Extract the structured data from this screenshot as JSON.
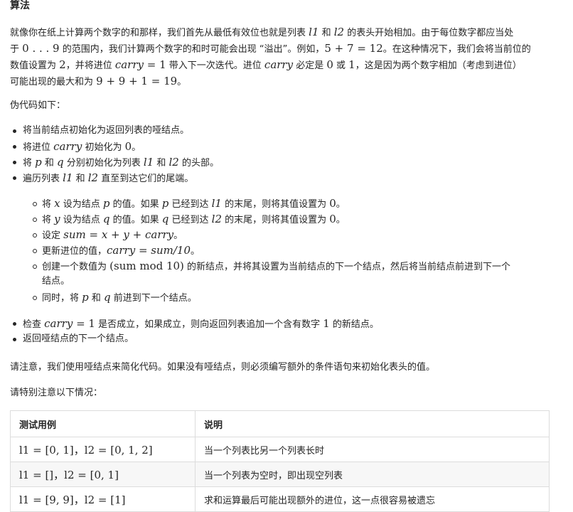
{
  "section_title": "算法",
  "para1": {
    "l1_a": "就像你在纸上计算两个数字的和那样，我们首先从最低有效位也就是列表 ",
    "l1_m1": "l1",
    "l1_b": " 和 ",
    "l1_m2": "l2",
    "l1_c": " 的表头开始相加。由于每位数字都应当处",
    "l2_a": "于 ",
    "l2_m1": "0 . . . 9",
    "l2_b": " 的范围内，我们计算两个数字的和时可能会出现 “溢出”。例如，",
    "l2_m2": "5 + 7 = 12",
    "l2_c": "。在这种情况下，我们会将当前位的",
    "l3_a": "数值设置为 ",
    "l3_m1": "2",
    "l3_b": "，并将进位 ",
    "l3_m2": "carry",
    "l3_m3": " = 1",
    "l3_c": " 带入下一次迭代。进位 ",
    "l3_m4": "carry",
    "l3_d": " 必定是 ",
    "l3_m5": "0",
    "l3_e": " 或 ",
    "l3_m6": "1",
    "l3_f": "，这是因为两个数字相加（考虑到进位）",
    "l4_a": "可能出现的最大和为 ",
    "l4_m1": "9 + 9 + 1 = 19",
    "l4_b": "。"
  },
  "pseudo_intro": "伪代码如下：",
  "bullets": {
    "b1": "将当前结点初始化为返回列表的哑结点。",
    "b2_a": "将进位 ",
    "b2_m1": "carry",
    "b2_b": " 初始化为 ",
    "b2_m2": "0",
    "b2_c": "。",
    "b3_a": "将 ",
    "b3_m1": "p",
    "b3_b": " 和 ",
    "b3_m2": "q",
    "b3_c": " 分别初始化为列表 ",
    "b3_m3": "l1",
    "b3_d": " 和 ",
    "b3_m4": "l2",
    "b3_e": " 的头部。",
    "b4_a": "遍历列表 ",
    "b4_m1": "l1",
    "b4_b": " 和 ",
    "b4_m2": "l2",
    "b4_c": " 直至到达它们的尾端。",
    "b5_a": "检查 ",
    "b5_m1": "carry",
    "b5_m2": " = 1",
    "b5_b": " 是否成立，如果成立，则向返回列表追加一个含有数字 ",
    "b5_m3": "1",
    "b5_c": " 的新结点。",
    "b6": "返回哑结点的下一个结点。"
  },
  "sub": {
    "s1_a": "将 ",
    "s1_m1": "x",
    "s1_b": " 设为结点 ",
    "s1_m2": "p",
    "s1_c": " 的值。如果 ",
    "s1_m3": "p",
    "s1_d": " 已经到达 ",
    "s1_m4": "l1",
    "s1_e": " 的末尾，则将其值设置为 ",
    "s1_m5": "0",
    "s1_f": "。",
    "s2_a": "将 ",
    "s2_m1": "y",
    "s2_b": " 设为结点 ",
    "s2_m2": "q",
    "s2_c": " 的值。如果 ",
    "s2_m3": "q",
    "s2_d": " 已经到达 ",
    "s2_m4": "l2",
    "s2_e": " 的末尾，则将其值设置为 ",
    "s2_m5": "0",
    "s2_f": "。",
    "s3_a": "设定 ",
    "s3_m1": "sum = x + y + carry",
    "s3_b": "。",
    "s4_a": "更新进位的值，",
    "s4_m1": "carry = sum/10",
    "s4_b": "。",
    "s5_a": "创建一个数值为 ",
    "s5_m1": "(sum mod 10)",
    "s5_b": " 的新结点，并将其设置为当前结点的下一个结点，然后将当前结点前进到下一个",
    "s5_c": "结点。",
    "s6_a": "同时，将 ",
    "s6_m1": "p",
    "s6_b": " 和 ",
    "s6_m2": "q",
    "s6_c": " 前进到下一个结点。"
  },
  "note": "请注意，我们使用哑结点来简化代码。如果没有哑结点，则必须编写额外的条件语句来初始化表头的值。",
  "special": "请特别注意以下情况：",
  "table": {
    "headers": [
      "测试用例",
      "说明"
    ],
    "rows": [
      {
        "case": "l1 = [0, 1]，l2 = [0, 1, 2]",
        "desc": "当一个列表比另一个列表长时"
      },
      {
        "case": "l1 = []，l2 = [0, 1]",
        "desc": "当一个列表为空时，即出现空列表"
      },
      {
        "case": "l1 = [9, 9]，l2 = [1]",
        "desc": "求和运算最后可能出现额外的进位，这一点很容易被遗忘"
      }
    ]
  }
}
